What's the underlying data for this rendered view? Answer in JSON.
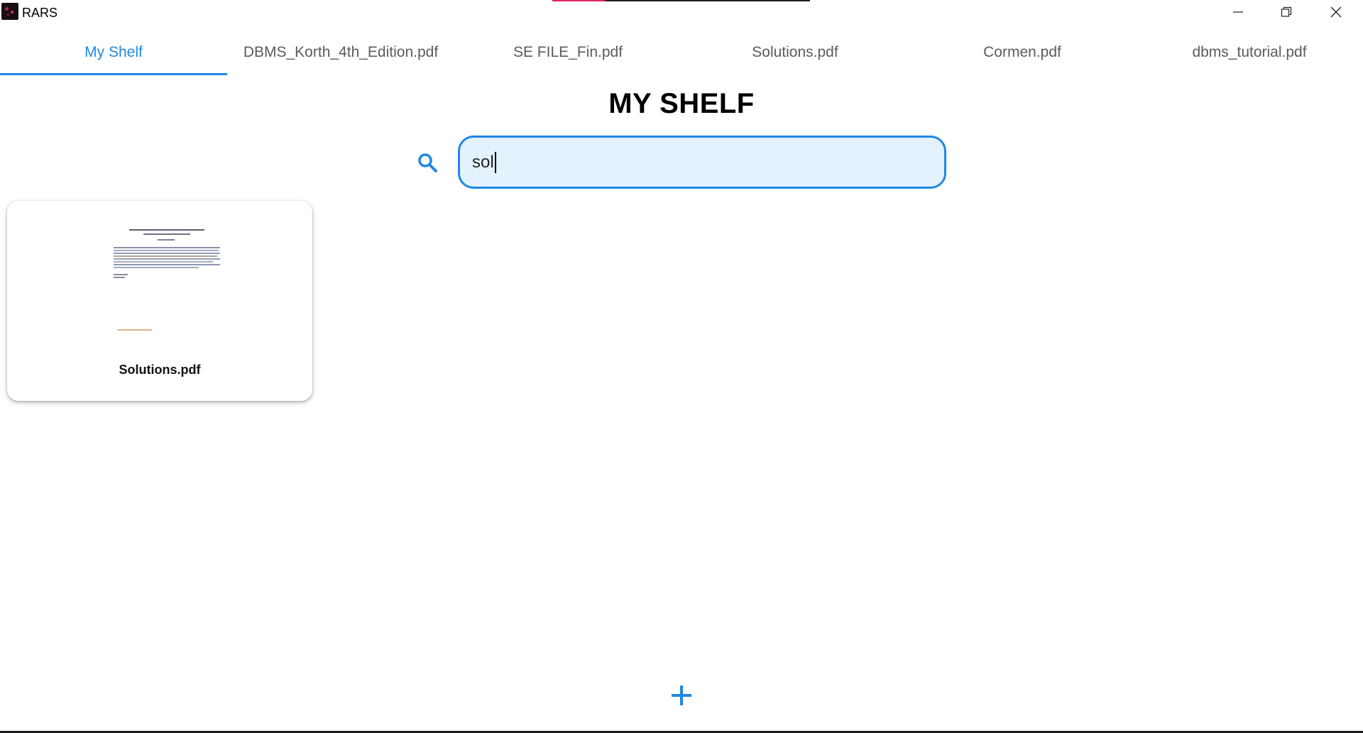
{
  "window": {
    "app_title": "RARS",
    "controls": {
      "minimize": "minimize-icon",
      "maximize": "restore-icon",
      "close": "close-icon"
    },
    "accent": "#e0245e"
  },
  "tabs": [
    {
      "label": "My Shelf",
      "active": true
    },
    {
      "label": "DBMS_Korth_4th_Edition.pdf",
      "active": false
    },
    {
      "label": "SE FILE_Fin.pdf",
      "active": false
    },
    {
      "label": "Solutions.pdf",
      "active": false
    },
    {
      "label": "Cormen.pdf",
      "active": false
    },
    {
      "label": "dbms_tutorial.pdf",
      "active": false
    }
  ],
  "main": {
    "title": "MY SHELF",
    "search": {
      "icon": "search-icon",
      "value": "sol"
    },
    "results": [
      {
        "label": "Solutions.pdf",
        "thumbnail": "pdf-page-thumbnail"
      }
    ],
    "add_icon": "plus-icon"
  },
  "colors": {
    "primary": "#1e88e5",
    "search_bg": "#e3f2fd",
    "tab_inactive": "#5b5b5b"
  }
}
